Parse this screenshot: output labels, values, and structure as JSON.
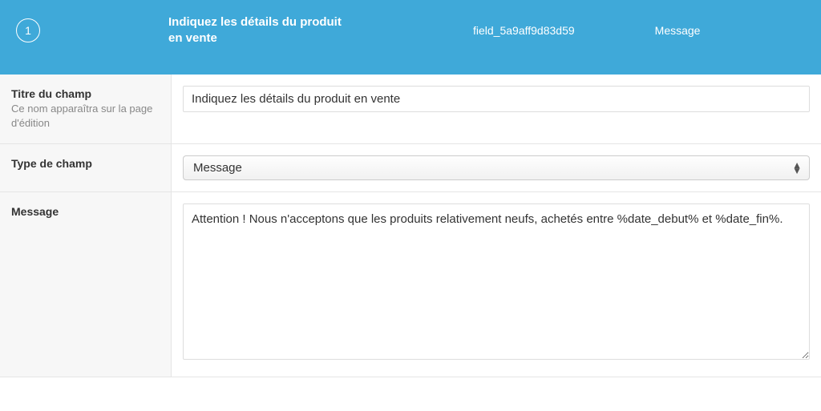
{
  "header": {
    "order": "1",
    "title": "Indiquez les détails du produit en vente",
    "field_key": "field_5a9aff9d83d59",
    "type": "Message"
  },
  "rows": {
    "title": {
      "label": "Titre du champ",
      "desc": "Ce nom apparaîtra sur la page d'édition",
      "value": "Indiquez les détails du produit en vente"
    },
    "type": {
      "label": "Type de champ",
      "value": "Message"
    },
    "message": {
      "label": "Message",
      "value": "Attention ! Nous n'acceptons que les produits relativement neufs, achetés entre %date_debut% et %date_fin%."
    }
  }
}
